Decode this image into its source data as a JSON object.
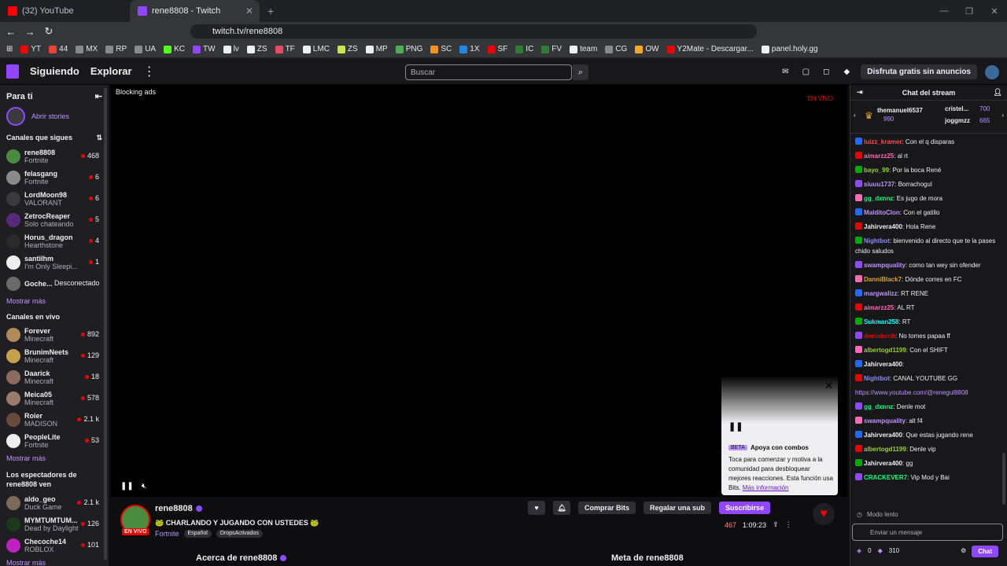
{
  "browser": {
    "tabs": [
      {
        "label": "(32) YouTube",
        "color": "#ff0000"
      },
      {
        "label": "rene8808 - Twitch",
        "color": "#9147ff"
      }
    ],
    "new_tab": "+",
    "url": "twitch.tv/rene8808",
    "bookmarks": [
      {
        "label": "YT",
        "color": "#ff0000"
      },
      {
        "label": "44",
        "color": "#ea4335"
      },
      {
        "label": "MX",
        "color": "#8a8a8a"
      },
      {
        "label": "RP",
        "color": "#8a8a8a"
      },
      {
        "label": "UA",
        "color": "#8a8a8a"
      },
      {
        "label": "KC",
        "color": "#53fc18"
      },
      {
        "label": "TW",
        "color": "#9147ff"
      },
      {
        "label": "lv",
        "color": "#efeff1"
      },
      {
        "label": "ZS",
        "color": "#efeff1"
      },
      {
        "label": "TF",
        "color": "#e84a5f"
      },
      {
        "label": "LMC",
        "color": "#efeff1"
      },
      {
        "label": "ZS",
        "color": "#c8e64c"
      },
      {
        "label": "MP",
        "color": "#efeff1"
      },
      {
        "label": "PNG",
        "color": "#4caf50"
      },
      {
        "label": "SC",
        "color": "#f7931a"
      },
      {
        "label": "1X",
        "color": "#1e88e5"
      },
      {
        "label": "SF",
        "color": "#eb0400"
      },
      {
        "label": "IC",
        "color": "#2e7d32"
      },
      {
        "label": "FV",
        "color": "#2e7d32"
      },
      {
        "label": "team",
        "color": "#efeff1"
      },
      {
        "label": "CG",
        "color": "#8a8a8a"
      },
      {
        "label": "OW",
        "color": "#f9a825"
      },
      {
        "label": "Y2Mate - Descargar...",
        "color": "#eb0400"
      },
      {
        "label": "panel.holy.gg",
        "color": "#efeff1"
      }
    ]
  },
  "topnav": {
    "following": "Siguiendo",
    "browse": "Explorar",
    "search_placeholder": "Buscar",
    "promo": "Disfruta gratis sin anuncios"
  },
  "sidebar": {
    "title": "Para ti",
    "stories": "Abrir stories",
    "followed_header": "Canales que sigues",
    "followed": [
      {
        "name": "rene8808",
        "game": "Fortnite",
        "viewers": "468",
        "color": "#4a8c3f"
      },
      {
        "name": "felasgang",
        "game": "Fortnite",
        "viewers": "6",
        "color": "#8a8a8a"
      },
      {
        "name": "LordMoon98",
        "game": "VALORANT",
        "viewers": "6",
        "color": "#3a3a3d"
      },
      {
        "name": "ZetrocReaper",
        "game": "Solo chateando",
        "viewers": "5",
        "color": "#5a2a7a"
      },
      {
        "name": "Horus_dragon",
        "game": "Hearthstone",
        "viewers": "4",
        "color": "#2a2a2a"
      },
      {
        "name": "santilhm",
        "game": "I'm Only Sleepi...",
        "viewers": "1",
        "color": "#eeeeee"
      }
    ],
    "offline": {
      "name": "Goche...",
      "status": "Desconectado"
    },
    "show_more": "Mostrar más",
    "live_header": "Canales en vivo",
    "live": [
      {
        "name": "Forever",
        "game": "Minecraft",
        "viewers": "892",
        "color": "#b08a5a"
      },
      {
        "name": "BrunimNeets",
        "game": "Minecraft",
        "viewers": "129",
        "color": "#c6a04a"
      },
      {
        "name": "Daarick",
        "game": "Minecraft",
        "viewers": "18",
        "color": "#8a6a5a"
      },
      {
        "name": "Meica05",
        "game": "Minecraft",
        "viewers": "578",
        "color": "#9a7a6a"
      },
      {
        "name": "Roier",
        "game": "MADISON",
        "viewers": "2.1 k",
        "color": "#6a4a3a"
      },
      {
        "name": "PeopleLite",
        "game": "Fortnite",
        "viewers": "53",
        "color": "#eeeeee"
      }
    ],
    "show_more2": "Mostrar más",
    "viewers_header": "Los espectadores de rene8808 ven",
    "viewers": [
      {
        "name": "aldo_geo",
        "game": "Duck Game",
        "viewers": "2.1 k",
        "color": "#7a6a5a"
      },
      {
        "name": "MYMTUMTUM...",
        "game": "Dead by Daylight",
        "viewers": "126",
        "color": "#1a3a1a"
      },
      {
        "name": "Checoche14",
        "game": "ROBLOX",
        "viewers": "101",
        "color": "#c020c0"
      }
    ],
    "show_more3": "Mostrar más"
  },
  "player": {
    "blocking": "Blocking ads",
    "live": "EN VIVO",
    "popup": {
      "beta": "BETA",
      "title": "Apoya con combos",
      "body": "Toca para comenzar y motiva a la comunidad para desbloquear mejores reacciones. Esta función usa Bits.",
      "link": "Más información"
    }
  },
  "channel": {
    "name": "rene8808",
    "live": "EN VIVO",
    "title": "🐸 CHARLANDO Y JUGANDO CON USTEDES 🐸",
    "game": "Fortnite",
    "tags": [
      "Español",
      "DropsActivados"
    ],
    "buy_bits": "Comprar Bits",
    "gift_sub": "Regalar una sub",
    "subscribe": "Suscribirse",
    "viewers": "467",
    "uptime": "1:09:23",
    "about": "Acerca de rene8808",
    "goal": "Meta de rene8808"
  },
  "chat": {
    "title": "Chat del stream",
    "leaders": [
      {
        "name": "themanuel6537",
        "score": "990"
      },
      {
        "name": "cristel...",
        "score": "700"
      },
      {
        "name": "joggmzz",
        "score": "665"
      }
    ],
    "messages": [
      {
        "user": "luizz_kramer",
        "color": "#ff4a4a",
        "text": ": Con el q disparas"
      },
      {
        "user": "aimarzz25",
        "color": "#ff69b4",
        "text": ": al rt"
      },
      {
        "user": "bayo_99",
        "color": "#9acd32",
        "text": ": Por la boca René"
      },
      {
        "user": "siuuu1737",
        "color": "#bf94ff",
        "text": ": Borrachogul"
      },
      {
        "user": "gg_dxnnz",
        "color": "#00ff7f",
        "text": ": Es jugo de mora"
      },
      {
        "user": "MalditoClon",
        "color": "#bf94ff",
        "text": ": Con el gatillo"
      },
      {
        "user": "Jahirvera400",
        "color": "#efeff1",
        "text": ": Hola Rene"
      },
      {
        "user": "Nightbot",
        "color": "#8a8aff",
        "text": ": bienvenido al directo que te la pases chido saludos"
      },
      {
        "user": "swampquality",
        "color": "#bf94ff",
        "text": ": como tan wey sin ofender"
      },
      {
        "user": "DanniBlack7",
        "color": "#daa520",
        "text": ": Dónde corres en FC"
      },
      {
        "user": "margwalizz",
        "color": "#bf94ff",
        "text": ": RT RENE"
      },
      {
        "user": "aimarzz25",
        "color": "#ff69b4",
        "text": ": AL RT"
      },
      {
        "user": "Sukman258",
        "color": "#00ffff",
        "text": ": RT"
      },
      {
        "user": "deniabsnh",
        "color": "#eb0400",
        "text": ": No tomes papaa ff"
      },
      {
        "user": "albertogd1199",
        "color": "#9acd32",
        "text": ": Con el SHIFT"
      },
      {
        "user": "Jahirvera400",
        "color": "#efeff1",
        "text": ":"
      },
      {
        "user": "Nightbot",
        "color": "#8a8aff",
        "text": ": CANAL YOUTUBE GG"
      },
      {
        "user": "",
        "color": "#bf94ff",
        "text": "https://www.youtube.com/@renegul8808"
      },
      {
        "user": "gg_dxnnz",
        "color": "#00ff7f",
        "text": ": Denle mot"
      },
      {
        "user": "swampquality",
        "color": "#bf94ff",
        "text": ": alt f4"
      },
      {
        "user": "Jahirvera400",
        "color": "#efeff1",
        "text": ": Que estas jugando rene"
      },
      {
        "user": "albertogd1199",
        "color": "#9acd32",
        "text": ": Denle vip"
      },
      {
        "user": "Jahirvera400",
        "color": "#efeff1",
        "text": ": gg"
      },
      {
        "user": "CRACKEVER7",
        "color": "#00ff7f",
        "text": ": Vip Mod y Bai"
      }
    ],
    "slow_mode": "Modo lento",
    "input_placeholder": "Enviar un mensaje",
    "points": "0",
    "bits": "310",
    "chat_button": "Chat"
  }
}
